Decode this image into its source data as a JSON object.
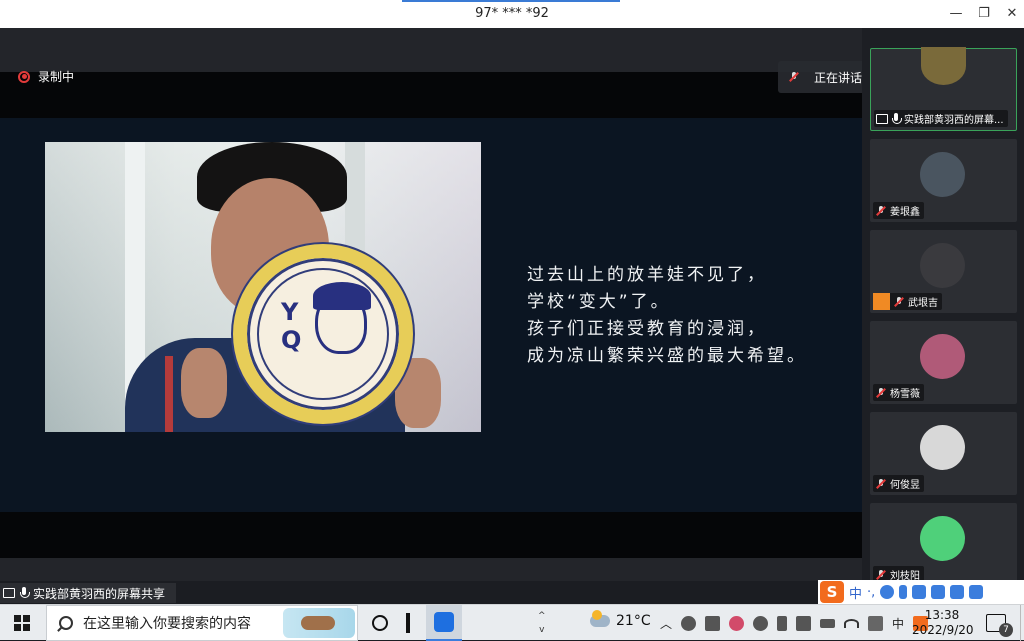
{
  "window": {
    "title": "97* *** *92",
    "minimize": "—",
    "maximize": "❐",
    "close": "✕"
  },
  "meeting": {
    "recording_label": "录制中",
    "speaking_label": "正在讲话: 实践部黄羽西;",
    "screen_share_label": "实践部黄羽西的屏幕共享"
  },
  "slide": {
    "lines": [
      "过去山上的放羊娃不见了，",
      "学校“变大”了。",
      "孩子们正接受教育的浸润，",
      "成为凉山繁荣兴盛的最大希望。"
    ],
    "plate_letters": [
      "Y",
      "Q"
    ]
  },
  "participants": [
    {
      "name": "实践部黄羽西的屏幕...",
      "mic": "on",
      "sharing": true,
      "active": true,
      "avatar_color": "#7a6a3a"
    },
    {
      "name": "姜垠鑫",
      "mic": "muted",
      "sharing": false,
      "active": false,
      "avatar_color": "#4a5560"
    },
    {
      "name": "武垠吉",
      "mic": "muted",
      "sharing": false,
      "active": false,
      "avatar_color": "#3a3a3e",
      "badge": true
    },
    {
      "name": "杨雪薇",
      "mic": "muted",
      "sharing": false,
      "active": false,
      "avatar_color": "#b05a78"
    },
    {
      "name": "何俊昱",
      "mic": "muted",
      "sharing": false,
      "active": false,
      "avatar_color": "#d8d8d8"
    },
    {
      "name": "刘枝阳",
      "mic": "muted",
      "sharing": false,
      "active": false,
      "avatar_color": "#4fd07a"
    }
  ],
  "ime": {
    "logo": "S",
    "mode": "中"
  },
  "taskbar": {
    "search_placeholder": "在这里输入你要搜索的内容",
    "weather_temp": "21°C",
    "tray_lang": "中",
    "time": "13:38",
    "date": "2022/9/20",
    "notification_count": "7",
    "scroll_up": "^",
    "scroll_down": "v"
  }
}
